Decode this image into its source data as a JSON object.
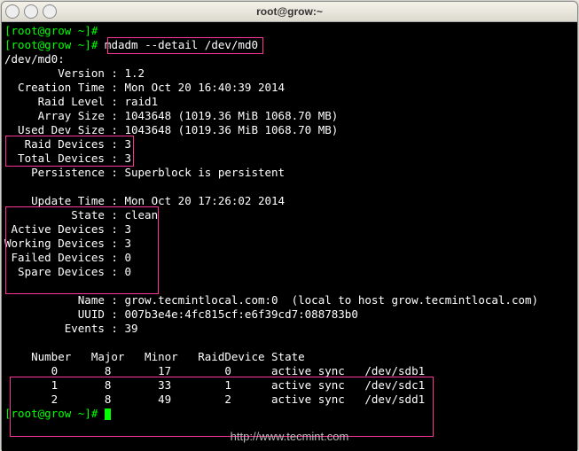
{
  "window": {
    "title": "root@grow:~"
  },
  "prompt": {
    "user_host": "root@grow",
    "cwd": "~",
    "hash": "#",
    "command": "mdadm --detail /dev/md0"
  },
  "output": {
    "device": "/dev/md0:",
    "fields": {
      "version": "        Version : 1.2",
      "ctime": "  Creation Time : Mon Oct 20 16:40:39 2014",
      "rlevel": "     Raid Level : raid1",
      "asize": "     Array Size : 1043648 (1019.36 MiB 1068.70 MB)",
      "udsize": "  Used Dev Size : 1043648 (1019.36 MiB 1068.70 MB)",
      "rdevs": "   Raid Devices : 3",
      "tdevs": "  Total Devices : 3",
      "persist": "    Persistence : Superblock is persistent",
      "utime": "    Update Time : Mon Oct 20 17:26:02 2014",
      "state": "          State : clean",
      "adev": " Active Devices : 3",
      "wdev": "Working Devices : 3",
      "fdev": " Failed Devices : 0",
      "sdev": "  Spare Devices : 0",
      "name": "           Name : grow.tecmintlocal.com:0  (local to host grow.tecmintlocal.com)",
      "uuid": "           UUID : 007b3e4e:4fc815cf:e6f39cd7:088783b0",
      "events": "         Events : 39"
    },
    "table": {
      "header": "    Number   Major   Minor   RaidDevice State",
      "rows": [
        "       0       8       17        0      active sync   /dev/sdb1",
        "       1       8       33        1      active sync   /dev/sdc1",
        "       2       8       49        2      active sync   /dev/sdd1"
      ]
    }
  },
  "watermark": "http://www.tecmint.com"
}
